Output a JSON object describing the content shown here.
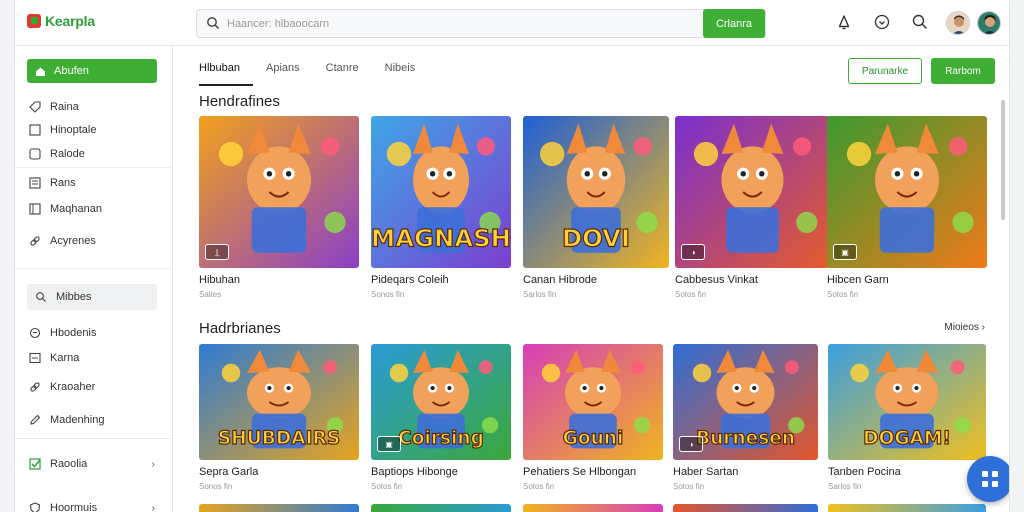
{
  "app": {
    "name": "Kearpla"
  },
  "search": {
    "placeholder": "Haancer: hlbaoocarn",
    "button": "Crlanra"
  },
  "header": {
    "icons": [
      "bell-icon",
      "download-icon",
      "search-icon"
    ]
  },
  "sidebar": {
    "primary": "Abufen",
    "items": [
      {
        "label": "Raina",
        "icon": "tag-icon"
      },
      {
        "label": "Hinoptale",
        "icon": "square-icon"
      },
      {
        "label": "Ralode",
        "icon": "square-icon"
      },
      {
        "label": "Rans",
        "icon": "list-icon"
      },
      {
        "label": "Maqhanan",
        "icon": "book-icon"
      },
      {
        "label": "Acyrenes",
        "icon": "link-icon"
      }
    ],
    "section2": [
      {
        "label": "Mibbes",
        "icon": "search-icon"
      },
      {
        "label": "Hbodenis",
        "icon": "chat-icon"
      },
      {
        "label": "Karna",
        "icon": "list-icon"
      },
      {
        "label": "Kraoaher",
        "icon": "link-icon"
      },
      {
        "label": "Madenhing",
        "icon": "pen-icon"
      },
      {
        "label": "Raoolia",
        "icon": "check-icon",
        "chevron": "›"
      },
      {
        "label": "Hoormuis",
        "icon": "shield-icon",
        "chevron": "›"
      }
    ]
  },
  "tabs": [
    "Hlbuban",
    "Apians",
    "Ctanre",
    "Nibeis"
  ],
  "actions": {
    "outline": "Parunarke",
    "solid": "Rarbom"
  },
  "sections": [
    {
      "title": "Hendrafines",
      "more": "",
      "cards": [
        {
          "title": "Hibuhan",
          "meta": "Saltes",
          "badge": "l̲",
          "colors": [
            "#f2a11d",
            "#8a3fc8"
          ]
        },
        {
          "title": "Pideqars Coleih",
          "meta": "Sonos   fin",
          "art_text": "MAGNASH",
          "colors": [
            "#3fa6e6",
            "#7b3fd1"
          ]
        },
        {
          "title": "Canan Hibrode",
          "meta": "Sarlos   fin",
          "art_text": "DOVI",
          "colors": [
            "#1f5fd6",
            "#f0b420"
          ]
        },
        {
          "title": "Cabbesus Vinkat",
          "meta": "Sotos   fin",
          "badge": "◑",
          "colors": [
            "#7a2fd0",
            "#e55c2a"
          ]
        },
        {
          "title": "Hibcen Garn",
          "meta": "Sotos   fin",
          "badge": "▣",
          "colors": [
            "#3b9a30",
            "#f07a1a"
          ]
        }
      ]
    },
    {
      "title": "Hadrbrianes",
      "more": "Mioieos ›",
      "cards": [
        {
          "title": "Sepra Garla",
          "meta": "Sonos   fin",
          "art_text": "SHUBDAIRS",
          "colors": [
            "#2f7bd3",
            "#e6a420"
          ]
        },
        {
          "title": "Baptiops Hibonge",
          "meta": "Sotos   fin",
          "art_text": "Coirsing",
          "badge": "▣",
          "colors": [
            "#2a9bd6",
            "#3ba83a"
          ]
        },
        {
          "title": "Pehatiers Se Hlbongan",
          "meta": "Sotos   fin",
          "art_text": "Gouni",
          "colors": [
            "#d63fb8",
            "#f0b420"
          ]
        },
        {
          "title": "Haber Sartan",
          "meta": "Sotos   fin",
          "art_text": "Burnesen",
          "badge": "◑",
          "colors": [
            "#2f6ed6",
            "#e4562a"
          ]
        },
        {
          "title": "Tanben Pocina",
          "meta": "Sarlos   fin",
          "art_text": "DOGAM!",
          "colors": [
            "#3a9fe0",
            "#f0c020"
          ]
        }
      ]
    }
  ],
  "colors": {
    "accent": "#3eae34",
    "fab": "#2e6fd8"
  }
}
